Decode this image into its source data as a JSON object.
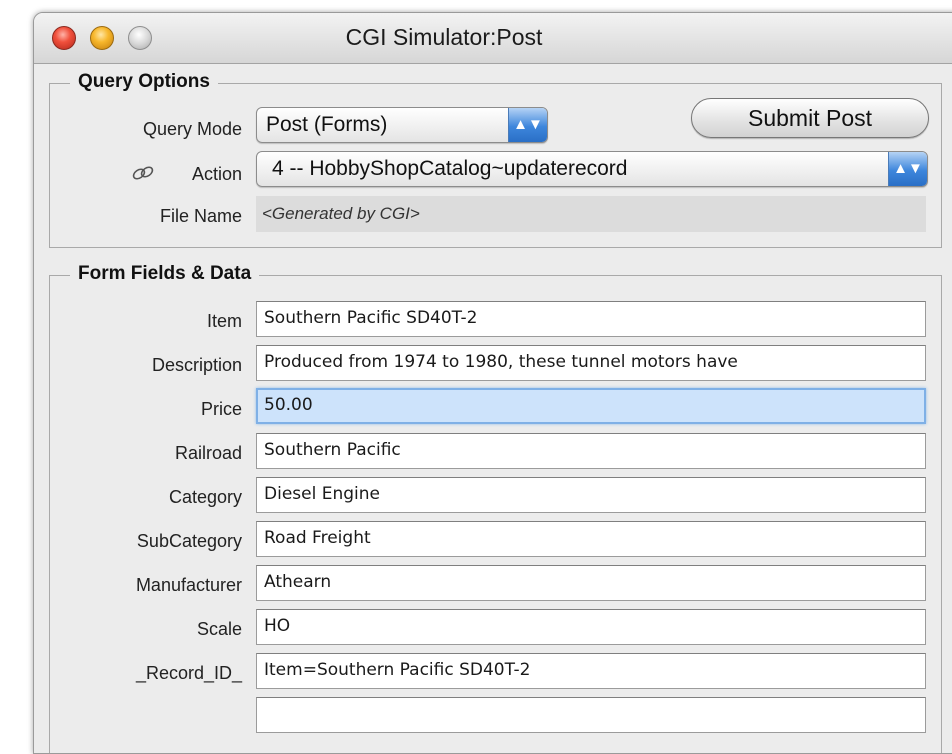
{
  "window": {
    "title": "CGI Simulator:Post"
  },
  "query_options": {
    "group_title": "Query Options",
    "query_mode_label": "Query Mode",
    "query_mode_value": "Post (Forms)",
    "action_label": "Action",
    "action_value": "4 -- HobbyShopCatalog~updaterecord",
    "file_name_label": "File Name",
    "file_name_value": "<Generated by CGI>",
    "submit_label": "Submit Post"
  },
  "form_fields": {
    "group_title": "Form Fields & Data",
    "fields": [
      {
        "label": "Item",
        "value": "Southern Pacific SD40T-2"
      },
      {
        "label": "Description",
        "value": "Produced from 1974 to 1980, these tunnel motors have"
      },
      {
        "label": "Price",
        "value": "50.00"
      },
      {
        "label": "Railroad",
        "value": "Southern Pacific"
      },
      {
        "label": "Category",
        "value": "Diesel Engine"
      },
      {
        "label": "SubCategory",
        "value": "Road Freight"
      },
      {
        "label": "Manufacturer",
        "value": "Athearn"
      },
      {
        "label": "Scale",
        "value": "HO"
      },
      {
        "label": "_Record_ID_",
        "value": "Item=Southern Pacific SD40T-2"
      },
      {
        "label": "",
        "value": ""
      }
    ]
  },
  "colors": {
    "focus": "#cde3fb",
    "popup_arrow": "#3d86dc"
  }
}
